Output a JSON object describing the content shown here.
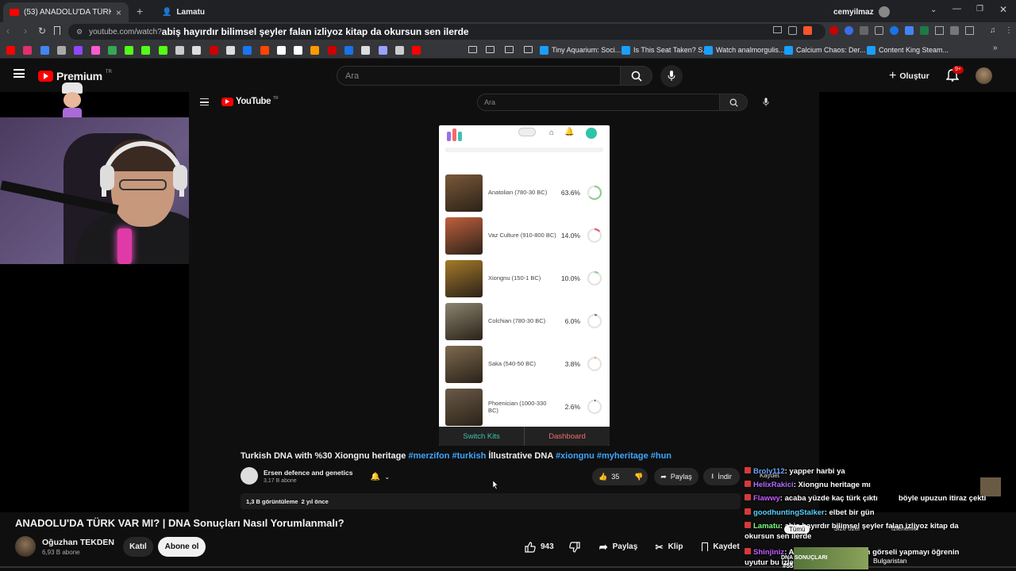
{
  "browser": {
    "active_tab_title": "(53) ANADOLU'DA TÜRK VAR MI...",
    "second_tab_title": "Lamatu",
    "profile_name": "cemyilmaz",
    "url_prefix": "youtube.com/watch?",
    "url_overlay": "abiş hayırdır bilimsel şeyler falan izliyoz kitap da okursun sen ilerde",
    "bookmarks": [
      "Tiny Aquarium: Soci...",
      "Is This Seat Taken? S...",
      "Watch analmorgulis...",
      "Calcium Chaos: Der...",
      "Content King Steam..."
    ]
  },
  "youtube": {
    "logo_text": "Premium",
    "logo_sup": "TR",
    "search_placeholder": "Ara",
    "create_label": "Oluştur",
    "notif_badge": "9+"
  },
  "inner": {
    "logo_text": "YouTube",
    "logo_sup": "TR",
    "search_placeholder": "Ara",
    "dna_results": [
      {
        "label": "Anatolian (780-30 BC)",
        "pct": "63.6%",
        "value": 0.636,
        "ring": "#8fd18f",
        "thumb": "#7a5838"
      },
      {
        "label": "Vaz Culture (910-800 BC)",
        "pct": "14.0%",
        "value": 0.14,
        "ring": "#e65a6a",
        "thumb": "#c0603e"
      },
      {
        "label": "Xiongnu (150-1 BC)",
        "pct": "10.0%",
        "value": 0.1,
        "ring": "#8fd18f",
        "thumb": "#a47a2a"
      },
      {
        "label": "Colchian (780-30 BC)",
        "pct": "6.0%",
        "value": 0.06,
        "ring": "#7a7a7a",
        "thumb": "#8a8470"
      },
      {
        "label": "Saka (540-50 BC)",
        "pct": "3.8%",
        "value": 0.038,
        "ring": "#f0a050",
        "thumb": "#7d6a50"
      },
      {
        "label": "Phoenician (1000-330 BC)",
        "pct": "2.6%",
        "value": 0.026,
        "ring": "#444444",
        "thumb": "#6a5a48"
      }
    ],
    "switch_kits": "Switch Kits",
    "dashboard": "Dashboard",
    "title_plain": "Turkish DNA with %30 Xiongnu heritage",
    "title_tags_1": "#merzifon #turkish",
    "title_plain_2": "İllustrative DNA",
    "title_tags_2": "#xiongnu #myheritage #hun",
    "channel": "Ersen defence and genetics",
    "subs": "3,17 B abone",
    "likes": "35",
    "share": "Paylaş",
    "download": "İndir",
    "views": "1,3 B görüntüleme  2 yıl önce"
  },
  "chat": [
    {
      "user": "Broly112",
      "color": "#6ea8ff",
      "msg": ": yapper harbi ya"
    },
    {
      "user": "HelixRakici",
      "color": "#b26bff",
      "msg": ": Xiongnu heritage mı"
    },
    {
      "user": "Flawwy",
      "color": "#c45cff",
      "msg": ": acaba yüzde kaç türk çıktı"
    },
    {
      "user": "",
      "color": "#fff",
      "msg": "böyle upuzun itiraz çekti"
    },
    {
      "user": "goodhuntingStalker",
      "color": "#5ad0ff",
      "msg": ": elbet bir gün"
    },
    {
      "user": "Lamatu",
      "color": "#7cff7c",
      "msg": ": abiş hayırdır bilimsel şeyler falan izliyoz kitap da okursun sen ilerde"
    },
    {
      "user": "Shinjiniz",
      "color": "#c45cff",
      "msg": ": Az hitabet ve arka plan görseli yapmayı öğrenin uyutur bu izleyici"
    }
  ],
  "chat_overlay": {
    "kaydet": "Kaydet",
    "tumu": "Tümü",
    "size_ozel": "Size özel",
    "izlenenler": "İzlenenler",
    "bulgaristan": "Bulgaristan",
    "dna_sonuclari": "DNA SONUÇLARI",
    "badge": "#55"
  },
  "video": {
    "title": "ANADOLU'DA TÜRK VAR MI? | DNA Sonuçları Nasıl Yorumlanmalı?",
    "channel": "Oğuzhan TEKDEN",
    "subs": "6,93 B abone",
    "join": "Katıl",
    "subscribe": "Abone ol",
    "likes": "943",
    "share": "Paylaş",
    "clip": "Klip",
    "save": "Kaydet"
  }
}
